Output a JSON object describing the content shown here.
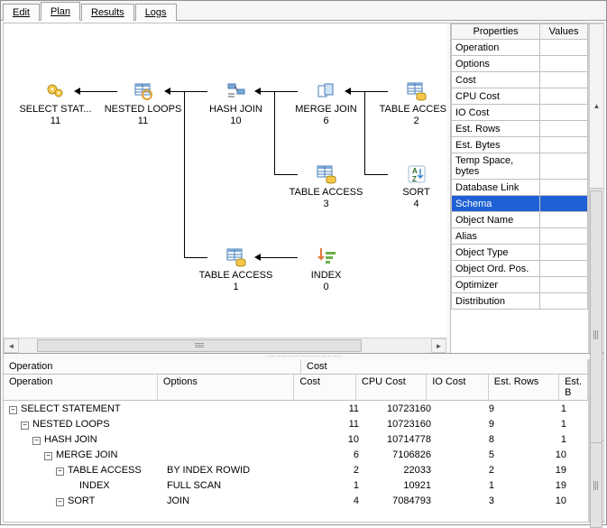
{
  "tabs": [
    "Edit",
    "Plan",
    "Results",
    "Logs"
  ],
  "active_tab": 1,
  "nodes": {
    "select": {
      "label": "SELECT STAT...",
      "sub": "11"
    },
    "nested": {
      "label": "NESTED LOOPS",
      "sub": "11"
    },
    "hash": {
      "label": "HASH JOIN",
      "sub": "10"
    },
    "merge": {
      "label": "MERGE JOIN",
      "sub": "6"
    },
    "ta2": {
      "label": "TABLE ACCESS",
      "sub": "2"
    },
    "ta3": {
      "label": "TABLE ACCESS",
      "sub": "3"
    },
    "sort": {
      "label": "SORT",
      "sub": "4"
    },
    "ta1": {
      "label": "TABLE ACCESS",
      "sub": "1"
    },
    "index": {
      "label": "INDEX",
      "sub": "0"
    }
  },
  "properties": {
    "headers": [
      "Properties",
      "Values"
    ],
    "rows": [
      "Operation",
      "Options",
      "Cost",
      "CPU Cost",
      "IO Cost",
      "Est. Rows",
      "Est. Bytes",
      "Temp Space, bytes",
      "Database Link",
      "Schema",
      "Object Name",
      "Alias",
      "Object Type",
      "Object Ord. Pos.",
      "Optimizer",
      "Distribution"
    ],
    "selected_index": 9
  },
  "grid": {
    "group_headers": [
      "Operation",
      "Cost"
    ],
    "headers": {
      "operation": "Operation",
      "options": "Options",
      "cost": "Cost",
      "cpu": "CPU Cost",
      "io": "IO Cost",
      "rows": "Est. Rows",
      "bytes": "Est. B"
    },
    "rows": [
      {
        "indent": 0,
        "toggle": "-",
        "op": "SELECT STATEMENT",
        "opt": "",
        "cost": "11",
        "cpu": "10723160",
        "io": "9",
        "rows": "1"
      },
      {
        "indent": 1,
        "toggle": "-",
        "op": "NESTED LOOPS",
        "opt": "",
        "cost": "11",
        "cpu": "10723160",
        "io": "9",
        "rows": "1"
      },
      {
        "indent": 2,
        "toggle": "-",
        "op": "HASH JOIN",
        "opt": "",
        "cost": "10",
        "cpu": "10714778",
        "io": "8",
        "rows": "1"
      },
      {
        "indent": 3,
        "toggle": "-",
        "op": "MERGE JOIN",
        "opt": "",
        "cost": "6",
        "cpu": "7106826",
        "io": "5",
        "rows": "10"
      },
      {
        "indent": 4,
        "toggle": "-",
        "op": "TABLE ACCESS",
        "opt": "BY INDEX ROWID",
        "cost": "2",
        "cpu": "22033",
        "io": "2",
        "rows": "19"
      },
      {
        "indent": 5,
        "toggle": "",
        "op": "INDEX",
        "opt": "FULL SCAN",
        "cost": "1",
        "cpu": "10921",
        "io": "1",
        "rows": "19"
      },
      {
        "indent": 4,
        "toggle": "-",
        "op": "SORT",
        "opt": "JOIN",
        "cost": "4",
        "cpu": "7084793",
        "io": "3",
        "rows": "10"
      }
    ]
  }
}
